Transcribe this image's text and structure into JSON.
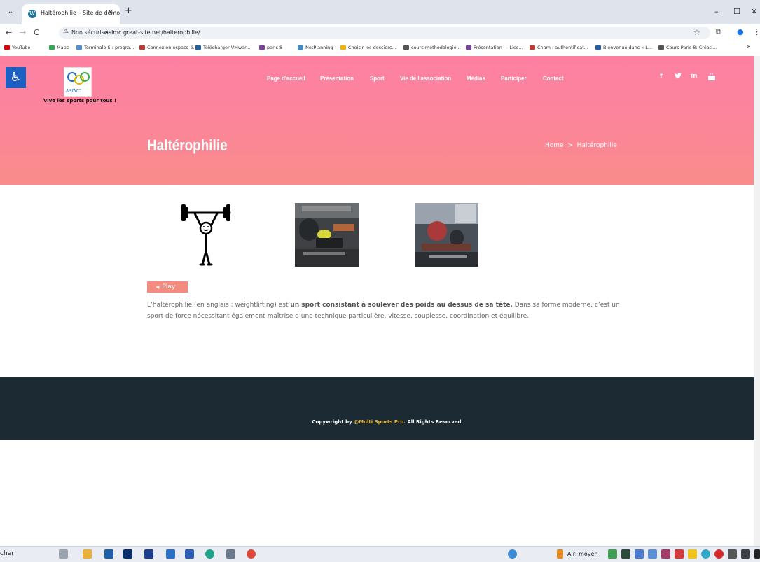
{
  "browser": {
    "tab_title": "Haltérophilie – Site de démo",
    "new_tab": "+",
    "tab_close": "×",
    "tab_menu": "⌄",
    "win_min": "–",
    "win_max": "☐",
    "win_close": "✕",
    "back": "←",
    "forward": "→",
    "reload": "C",
    "security_label": "Non sécurisé",
    "url": "asimc.great-site.net/halterophilie/",
    "star": "☆",
    "extensions": "⧉",
    "profile": "●",
    "menu": "⋮",
    "bookmarks": [
      {
        "label": "YouTube",
        "color": "#e00000"
      },
      {
        "label": "Maps",
        "color": "#34a853"
      },
      {
        "label": "Terminale S : progra...",
        "color": "#4a90d9"
      },
      {
        "label": "Connexion espace é...",
        "color": "#c0392b"
      },
      {
        "label": "Télécharger VMwar...",
        "color": "#1f5fa8"
      },
      {
        "label": "paris 8",
        "color": "#7b3fa0"
      },
      {
        "label": "NetPlanning",
        "color": "#3b8dd6"
      },
      {
        "label": "Choisir les dossiers...",
        "color": "#f5b400"
      },
      {
        "label": "cours méthodologie...",
        "color": "#555555"
      },
      {
        "label": "Présentation — Lice...",
        "color": "#7b3fa0"
      },
      {
        "label": "Cnam : authentificat...",
        "color": "#c0392b"
      },
      {
        "label": "Bienvenue dans « L...",
        "color": "#1f5fa8"
      },
      {
        "label": "Cours Paris 8: Créati...",
        "color": "#555555"
      }
    ],
    "bookmarks_more": "»"
  },
  "site": {
    "tagline": "Vive les sports pour tous !",
    "logo_text": "ASIMC",
    "accessibility_icon": "♿",
    "nav": [
      "Page d'accueil",
      "Présentation",
      "Sport",
      "Vie de l'association",
      "Médias",
      "Participer",
      "Contact"
    ],
    "social": [
      "f",
      "t",
      "in",
      "yt"
    ],
    "page_title": "Haltérophilie",
    "breadcrumb": {
      "home": "Home",
      "sep": ">",
      "current": "Haltérophilie"
    },
    "play_label": "Play",
    "intro_before": "L’haltérophilie (en anglais : weightlifting) est ",
    "intro_bold": "un sport consistant à soulever des poids au dessus de sa tête.",
    "intro_after": " Dans sa forme moderne, c’est un sport de force nécessitant également maîtrise d’une technique particulière, vitesse, souplesse, coordination et équilibre.",
    "footer_prefix": "Copywright by ",
    "footer_brand": "@Multi Sports Pro",
    "footer_suffix": ". All Rights Reserved"
  },
  "taskbar": {
    "search_text": "cher",
    "air_quality": "Air: moyen"
  },
  "colors": {
    "hero_top": "#fd80a2",
    "hero_bottom": "#f98c8a",
    "play_button": "#f48b7f",
    "footer_bg": "#1b2a33",
    "footer_brand": "#e7b53c",
    "accessibility": "#1d60c4"
  }
}
